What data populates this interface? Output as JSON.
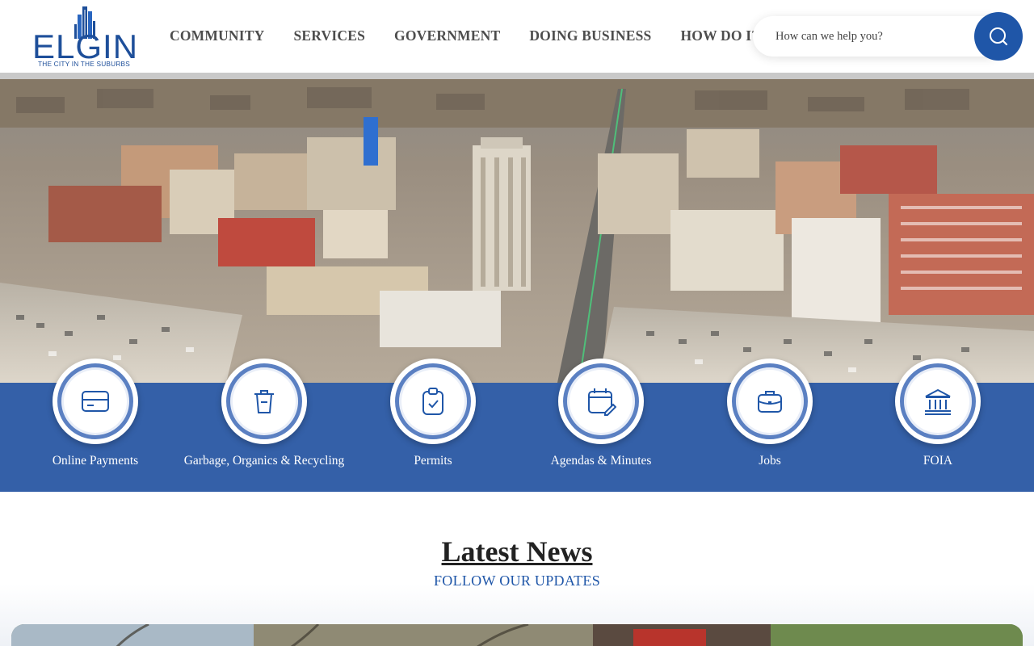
{
  "logo": {
    "word": "ELGIN",
    "tagline": "THE CITY IN THE SUBURBS"
  },
  "nav": [
    {
      "label": "COMMUNITY"
    },
    {
      "label": "SERVICES"
    },
    {
      "label": "GOVERNMENT"
    },
    {
      "label": "DOING BUSINESS"
    },
    {
      "label": "HOW DO I?"
    }
  ],
  "search": {
    "placeholder": "How can we help you?",
    "icon": "search-icon"
  },
  "quick_links": [
    {
      "label": "Online Payments",
      "icon": "payment-card-icon"
    },
    {
      "label": "Garbage, Organics & Recycling",
      "icon": "trash-can-icon"
    },
    {
      "label": "Permits",
      "icon": "clipboard-check-icon"
    },
    {
      "label": "Agendas & Minutes",
      "icon": "calendar-edit-icon"
    },
    {
      "label": "Jobs",
      "icon": "briefcase-icon"
    },
    {
      "label": "FOIA",
      "icon": "government-building-icon"
    }
  ],
  "news": {
    "title": "Latest News",
    "subtitle": "FOLLOW OUR UPDATES"
  },
  "colors": {
    "brand_blue": "#1f56a8",
    "band_blue": "#3460a8",
    "nav_text": "#4d4d4d"
  }
}
